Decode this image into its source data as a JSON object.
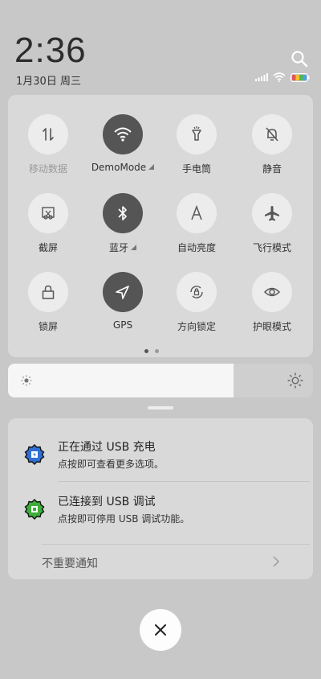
{
  "status": {
    "time": "2:36",
    "date": "1月30日 周三"
  },
  "tiles": [
    {
      "label": "移动数据",
      "icon": "mobile-data-icon",
      "active": false,
      "dim": true
    },
    {
      "label": "DemoMode",
      "icon": "wifi-icon",
      "active": true,
      "dim": false
    },
    {
      "label": "手电筒",
      "icon": "flashlight-icon",
      "active": false,
      "dim": false
    },
    {
      "label": "静音",
      "icon": "mute-bell-icon",
      "active": false,
      "dim": false
    },
    {
      "label": "截屏",
      "icon": "screenshot-icon",
      "active": false,
      "dim": false
    },
    {
      "label": "蓝牙",
      "icon": "bluetooth-icon",
      "active": true,
      "dim": false
    },
    {
      "label": "自动亮度",
      "icon": "auto-brightness-icon",
      "active": false,
      "dim": false
    },
    {
      "label": "飞行模式",
      "icon": "airplane-icon",
      "active": false,
      "dim": false
    },
    {
      "label": "锁屏",
      "icon": "lock-icon",
      "active": false,
      "dim": false
    },
    {
      "label": "GPS",
      "icon": "gps-icon",
      "active": true,
      "dim": false
    },
    {
      "label": "方向锁定",
      "icon": "rotation-lock-icon",
      "active": false,
      "dim": false
    },
    {
      "label": "护眼模式",
      "icon": "eye-icon",
      "active": false,
      "dim": false
    }
  ],
  "brightness": {
    "level": 0.74
  },
  "notifications": [
    {
      "title": "正在通过 USB 充电",
      "subtitle": "点按即可查看更多选项。",
      "icon": "usb-charging-icon",
      "color": "#2f6fd6"
    },
    {
      "title": "已连接到 USB 调试",
      "subtitle": "点按即可停用 USB 调试功能。",
      "icon": "usb-debug-icon",
      "color": "#3dae3a"
    }
  ],
  "unimportant_label": "不重要通知",
  "colors": {
    "active_tile": "#555555",
    "inactive_tile": "#ececec",
    "battery": [
      "#e25555",
      "#f1c232",
      "#4fb84f",
      "#4aa3e0"
    ]
  }
}
